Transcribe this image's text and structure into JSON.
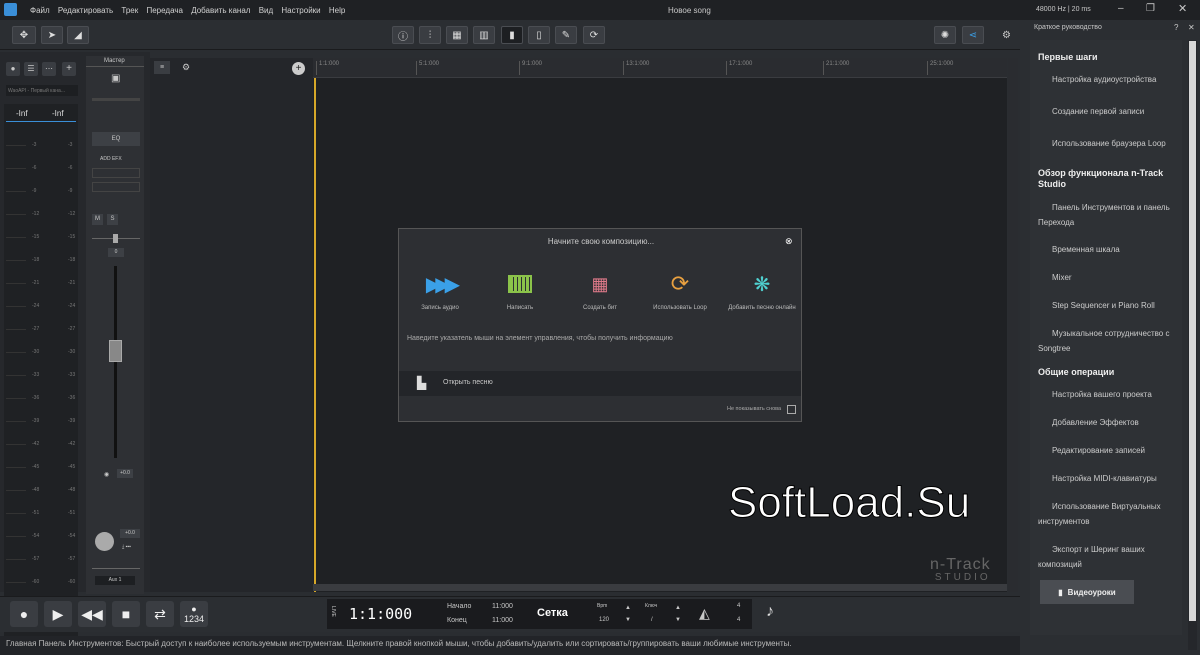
{
  "window": {
    "title": "Новое song",
    "rate": "48000 Hz | 20 ms"
  },
  "menu": [
    "Файл",
    "Редактировать",
    "Трек",
    "Передача",
    "Добавить канал",
    "Вид",
    "Настройки",
    "Help"
  ],
  "mixer": {
    "inf_left": "-Inf",
    "inf_right": "-Inf",
    "input_label": "WaoAPI - Первый кана...",
    "master_label": "Мастер",
    "eq": "EQ",
    "add_fx": "ADD EFX",
    "mute": "M",
    "solo": "S",
    "pan_value": "0",
    "vol_value": "+0.0",
    "out_value": "+0.0",
    "aux": "Aux 1",
    "meter_ticks": [
      "-3",
      "-6",
      "-9",
      "-12",
      "-15",
      "-18",
      "-21",
      "-24",
      "-27",
      "-30",
      "-33",
      "-36",
      "-39",
      "-42",
      "-45",
      "-48",
      "-51",
      "-54",
      "-57",
      "-60"
    ]
  },
  "ruler": [
    "1:1:000",
    "5:1:000",
    "9:1:000",
    "13:1:000",
    "17:1:000",
    "21:1:000",
    "25:1:000"
  ],
  "dialog": {
    "title": "Начните свою композицию...",
    "options": [
      {
        "label": "Запись аудио",
        "icon": "play-arrows-icon"
      },
      {
        "label": "Написать",
        "icon": "piano-icon"
      },
      {
        "label": "Создать бит",
        "icon": "pads-icon"
      },
      {
        "label": "Использовать Loop",
        "icon": "loop-icon"
      },
      {
        "label": "Добавить песню онлайн",
        "icon": "songtree-icon"
      }
    ],
    "hint": "Наведите указатель мыши на элемент управления, чтобы получить информацию",
    "open_song": "Открыть песню",
    "dont_show": "Не показывать снова"
  },
  "watermark": "SoftLoad.Su",
  "brand": {
    "line1": "n-Track",
    "line2": "STUDIO"
  },
  "transport": {
    "time": "1:1:000",
    "start_label": "Начало",
    "start_val": "11:000",
    "end_label": "Конец",
    "end_val": "11:000",
    "snap": "Сетка",
    "bpm_label": "Bpm",
    "bpm_val": "120",
    "key_label": "Ключ",
    "key_val": "/",
    "sig_top": "4",
    "sig_bottom": "4",
    "count": "1234",
    "live": "LIVE"
  },
  "status": "Главная Панель Инструментов:   Быстрый доступ к наиболее используемым инструментам. Щелкните правой кнопкой мыши, чтобы добавить/удалить или сортировать/группировать ваши любимые инструменты.",
  "guide": {
    "title": "Краткое руководство",
    "sections": [
      {
        "heading": "Первые шаги",
        "items": [
          "Настройка аудиоустройства",
          "Создание первой записи",
          "Использование браузера Loop"
        ]
      },
      {
        "heading": "Обзор функционала n-Track Studio",
        "items": [
          "Панель Инструментов и панель Перехода",
          "Временная шкала",
          "Mixer",
          "Step Sequencer и Piano Roll",
          "Музыкальное сотрудничество с Songtree"
        ]
      },
      {
        "heading": "Общие операции",
        "items": [
          "Настройка вашего проекта",
          "Добавление Эффектов",
          "Редактирование записей",
          "Настройка MIDI-клавиатуры",
          "Использование Виртуальных инструментов",
          "Экспорт и Шеринг ваших композиций"
        ]
      }
    ],
    "video": "Видеоуроки"
  },
  "colors": {
    "accent": "#3aa0e8",
    "bg": "#1f2124"
  }
}
